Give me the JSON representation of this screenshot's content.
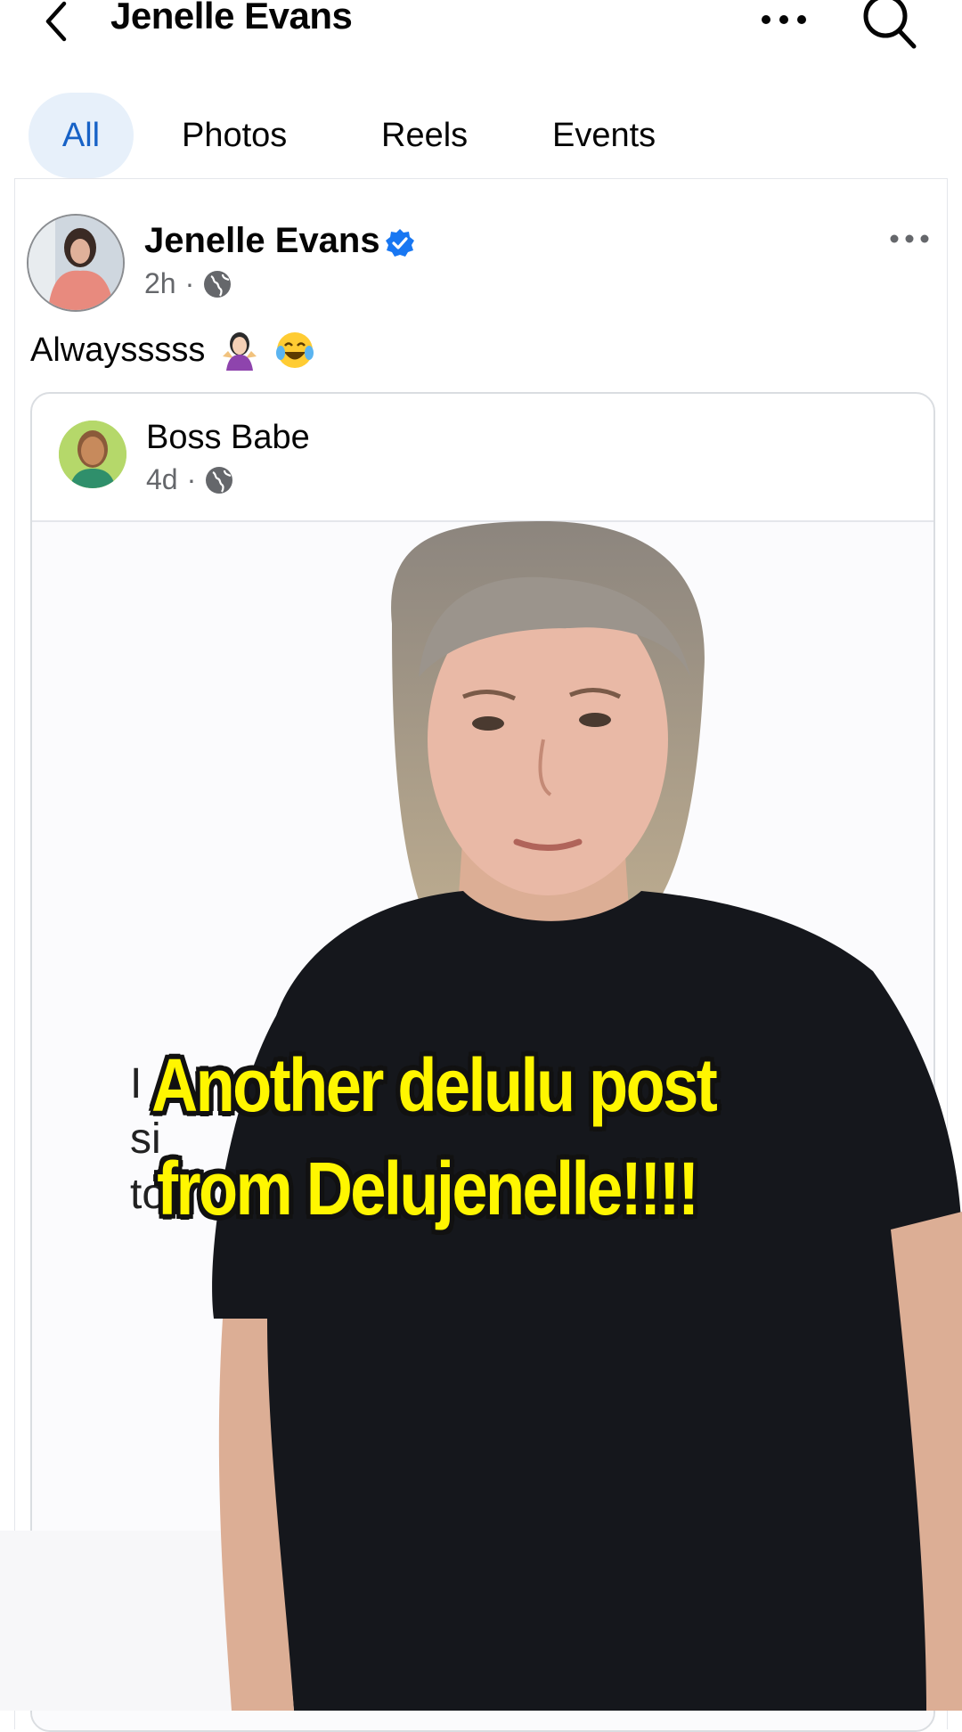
{
  "header": {
    "title": "Jenelle Evans",
    "icons": {
      "back": "back-chevron-icon",
      "more": "more-dots-icon",
      "search": "search-icon"
    }
  },
  "tabs": [
    {
      "label": "All",
      "active": true
    },
    {
      "label": "Photos",
      "active": false
    },
    {
      "label": "Reels",
      "active": false
    },
    {
      "label": "Events",
      "active": false
    }
  ],
  "post": {
    "author": "Jenelle Evans",
    "verified": true,
    "time": "2h",
    "privacy_icon": "globe-icon",
    "text": "Alwaysssss",
    "emojis": [
      "woman-shrugging-emoji",
      "tears-of-joy-emoji"
    ],
    "shared": {
      "author": "Boss Babe",
      "time": "4d",
      "privacy_icon": "globe-icon",
      "visible_text_fragments": [
        "I",
        "si",
        "to"
      ]
    }
  },
  "overlay": {
    "caption_lines": [
      "Another delulu post",
      "from Delujenelle!!!!"
    ],
    "caption_color": "#fff600"
  },
  "colors": {
    "accent": "#1762c6",
    "tab_active_bg": "#e7f0fa",
    "verified": "#1877f2",
    "meta_text": "#65676b"
  }
}
